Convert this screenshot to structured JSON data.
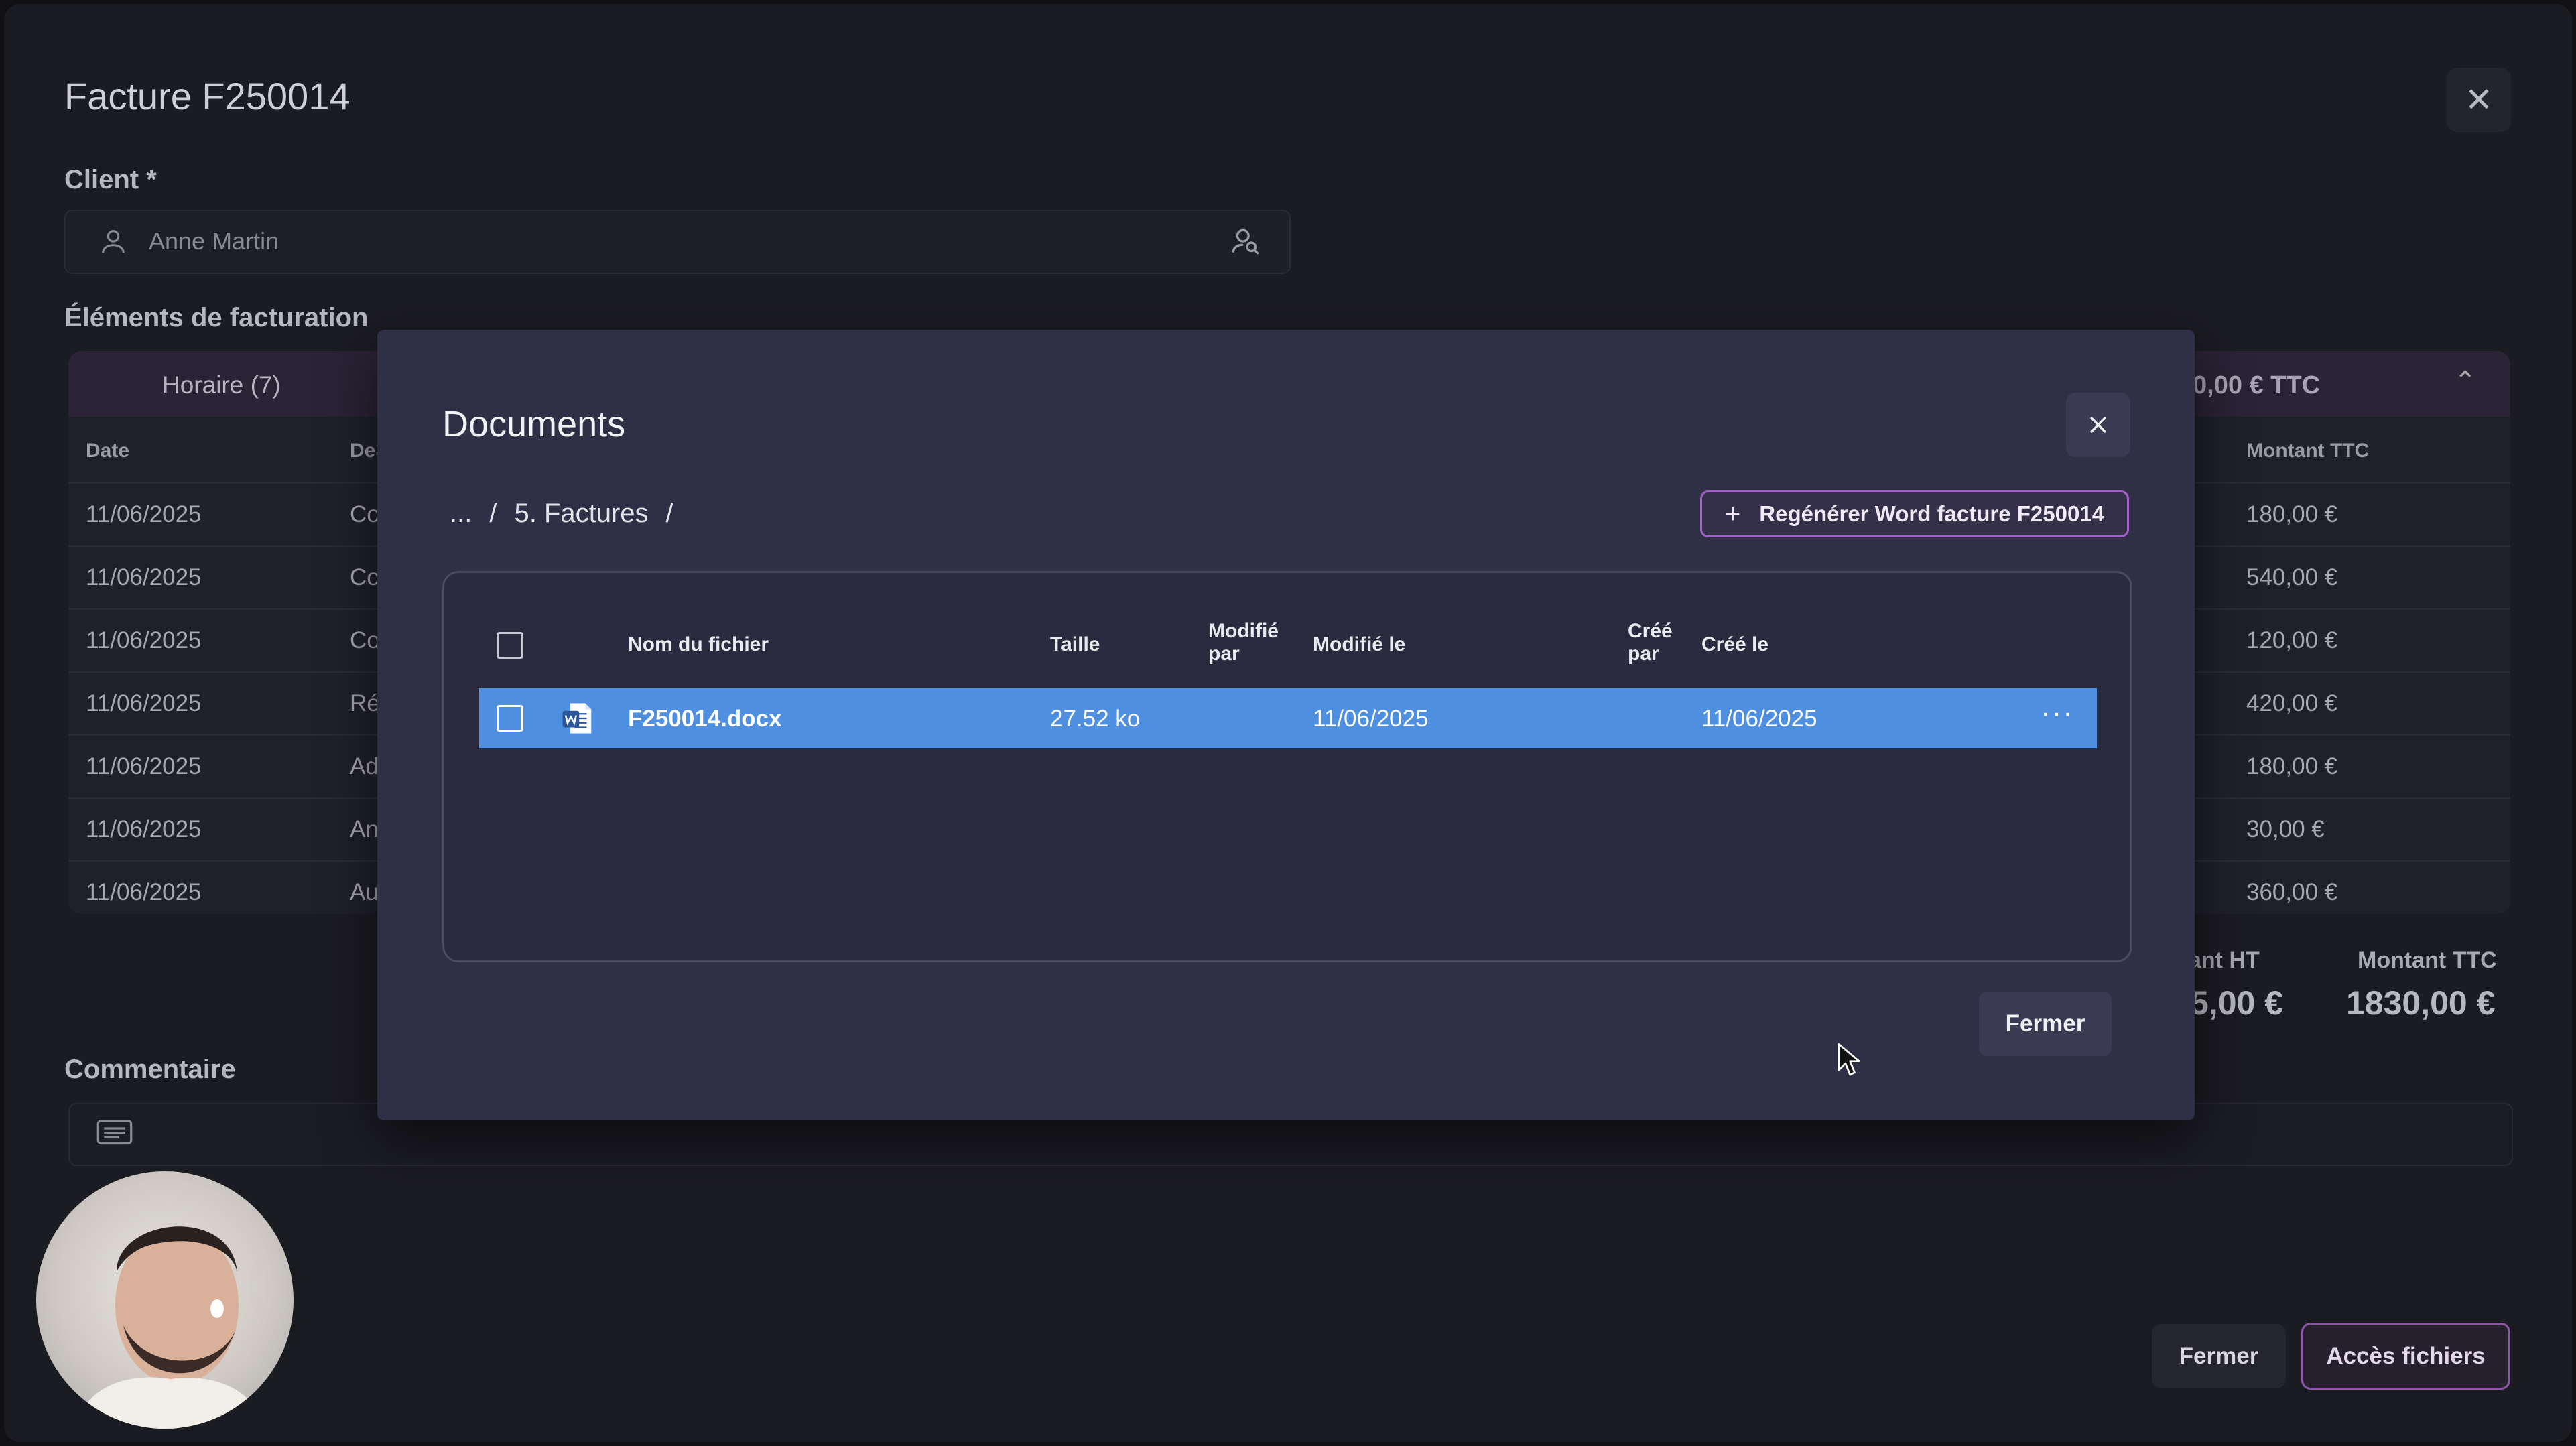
{
  "invoice": {
    "title": "Facture F250014",
    "client_label": "Client *",
    "client_value": "Anne Martin",
    "billing_label": "Éléments de facturation",
    "tab_label": "Horaire (7)",
    "header_total": "0,00 € TTC",
    "columns": {
      "date": "Date",
      "description": "Des",
      "amount_ttc": "Montant TTC"
    },
    "rows": [
      {
        "date": "11/06/2025",
        "desc": "Co",
        "ttc": "180,00 €"
      },
      {
        "date": "11/06/2025",
        "desc": "Co",
        "ttc": "540,00 €"
      },
      {
        "date": "11/06/2025",
        "desc": "Co",
        "ttc": "120,00 €"
      },
      {
        "date": "11/06/2025",
        "desc": "Ré",
        "ttc": "420,00 €"
      },
      {
        "date": "11/06/2025",
        "desc": "Ad",
        "ttc": "180,00 €"
      },
      {
        "date": "11/06/2025",
        "desc": "An",
        "ttc": "30,00 €"
      },
      {
        "date": "11/06/2025",
        "desc": "Au",
        "ttc": "360,00 €"
      }
    ],
    "totals": {
      "ht_label": "ant HT",
      "ht_value": "5,00 €",
      "ttc_label": "Montant TTC",
      "ttc_value": "1830,00 €"
    },
    "comment_label": "Commentaire",
    "buttons": {
      "close": "Fermer",
      "files": "Accès fichiers"
    }
  },
  "documents_modal": {
    "title": "Documents",
    "breadcrumb": [
      "...",
      "/",
      "5. Factures",
      "/"
    ],
    "regen_button": "Regénérer Word facture F250014",
    "columns": {
      "name": "Nom du fichier",
      "size": "Taille",
      "modified_by_1": "Modifié",
      "modified_by_2": "par",
      "modified_at": "Modifié le",
      "created_by_1": "Créé",
      "created_by_2": "par",
      "created_at": "Créé le"
    },
    "files": [
      {
        "name": "F250014.docx",
        "size": "27.52 ko",
        "modified_by": "",
        "modified_at": "11/06/2025",
        "created_by": "",
        "created_at": "11/06/2025",
        "icon": "word-file-icon"
      }
    ],
    "close_button": "Fermer"
  },
  "colors": {
    "modal_bg": "#2f2f45",
    "selected_row": "#4f8fe0",
    "accent_purple": "#a262c9"
  }
}
